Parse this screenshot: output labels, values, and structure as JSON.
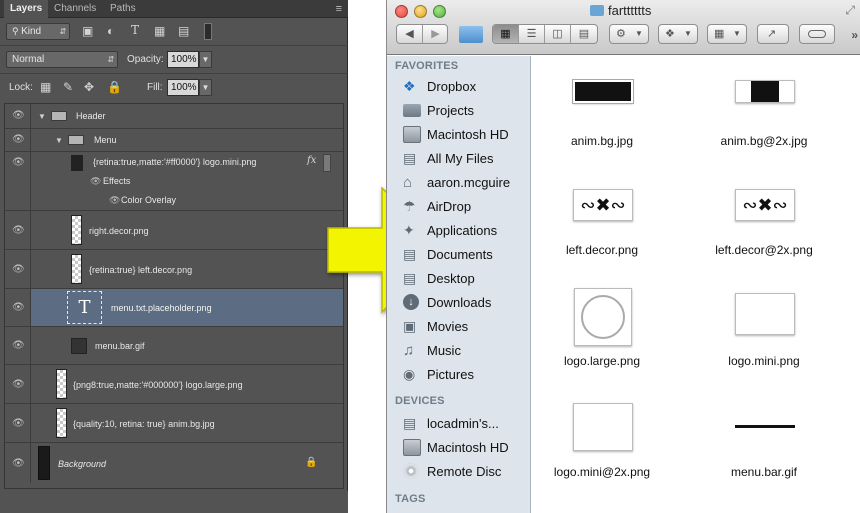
{
  "photoshop": {
    "tabs": [
      "Layers",
      "Channels",
      "Paths"
    ],
    "filter_kind": "Kind",
    "blend_mode": "Normal",
    "opacity_label": "Opacity:",
    "opacity_value": "100%",
    "lock_label": "Lock:",
    "fill_label": "Fill:",
    "fill_value": "100%",
    "layers": [
      {
        "name": "Header",
        "type": "group"
      },
      {
        "name": "Menu",
        "type": "group"
      },
      {
        "name": "{retina:true,matte:'#ff0000'} logo.mini.png",
        "type": "layer",
        "fx": "fx"
      },
      {
        "name": "Effects",
        "type": "effects"
      },
      {
        "name": "Color Overlay",
        "type": "effect"
      },
      {
        "name": "right.decor.png",
        "type": "layer"
      },
      {
        "name": "{retina:true} left.decor.png",
        "type": "layer"
      },
      {
        "name": "menu.txt.placeholder.png",
        "type": "text",
        "selected": true,
        "glyph": "T"
      },
      {
        "name": "menu.bar.gif",
        "type": "layer"
      },
      {
        "name": "{png8:true,matte:'#000000'} logo.large.png",
        "type": "layer"
      },
      {
        "name": "{quality:10, retina: true} anim.bg.jpg",
        "type": "layer"
      },
      {
        "name": "Background",
        "type": "background"
      }
    ]
  },
  "finder": {
    "title": "fartttttts",
    "sidebar": {
      "favorites_header": "FAVORITES",
      "favorites": [
        {
          "label": "Dropbox",
          "icon": "dropbox-icon"
        },
        {
          "label": "Projects",
          "icon": "folder-icon"
        },
        {
          "label": "Macintosh HD",
          "icon": "hard-drive-icon"
        },
        {
          "label": "All My Files",
          "icon": "all-files-icon"
        },
        {
          "label": "aaron.mcguire",
          "icon": "home-icon"
        },
        {
          "label": "AirDrop",
          "icon": "airdrop-icon"
        },
        {
          "label": "Applications",
          "icon": "applications-icon"
        },
        {
          "label": "Documents",
          "icon": "documents-icon"
        },
        {
          "label": "Desktop",
          "icon": "desktop-icon"
        },
        {
          "label": "Downloads",
          "icon": "downloads-icon"
        },
        {
          "label": "Movies",
          "icon": "movies-icon"
        },
        {
          "label": "Music",
          "icon": "music-icon"
        },
        {
          "label": "Pictures",
          "icon": "pictures-icon"
        }
      ],
      "devices_header": "DEVICES",
      "devices": [
        {
          "label": "locadmin's...",
          "icon": "computer-icon"
        },
        {
          "label": "Macintosh HD",
          "icon": "hard-drive-icon"
        },
        {
          "label": "Remote Disc",
          "icon": "disc-icon"
        }
      ],
      "tags_header": "TAGS"
    },
    "files": [
      {
        "name": "anim.bg.jpg"
      },
      {
        "name": "anim.bg@2x.jpg"
      },
      {
        "name": "left.decor.png"
      },
      {
        "name": "left.decor@2x.png"
      },
      {
        "name": "logo.large.png"
      },
      {
        "name": "logo.mini.png"
      },
      {
        "name": "logo.mini@2x.png"
      },
      {
        "name": "menu.bar.gif"
      }
    ],
    "colors": {
      "sidebar_bg": "#dde4eb",
      "arrow": "#f3f400"
    }
  }
}
